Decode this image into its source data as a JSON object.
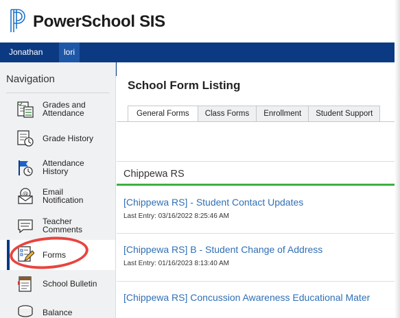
{
  "app": {
    "title": "PowerSchool SIS"
  },
  "user_bar": {
    "tabs": [
      "Jonathan",
      "lori"
    ]
  },
  "sidebar": {
    "heading": "Navigation",
    "items": [
      {
        "label_lines": [
          "Grades and",
          "Attendance"
        ],
        "icon": "gradebook-icon"
      },
      {
        "label_lines": [
          "Grade History"
        ],
        "icon": "grade-history-icon"
      },
      {
        "label_lines": [
          "Attendance",
          "History"
        ],
        "icon": "attendance-flag-icon"
      },
      {
        "label_lines": [
          "Email",
          "Notification"
        ],
        "icon": "email-icon"
      },
      {
        "label_lines": [
          "Teacher",
          "Comments"
        ],
        "icon": "comment-icon"
      },
      {
        "label_lines": [
          "Forms"
        ],
        "icon": "form-edit-icon",
        "active": true
      },
      {
        "label_lines": [
          "School Bulletin"
        ],
        "icon": "bulletin-icon"
      },
      {
        "label_lines": [
          "Balance"
        ],
        "icon": "coins-icon"
      }
    ]
  },
  "main": {
    "title": "School Form Listing",
    "tabs": [
      {
        "label": "General Forms",
        "active": true
      },
      {
        "label": "Class Forms"
      },
      {
        "label": "Enrollment"
      },
      {
        "label": "Student Support"
      }
    ],
    "school": "Chippewa RS",
    "forms": [
      {
        "title": "[Chippewa RS] - Student Contact Updates",
        "meta": "Last Entry: 03/16/2022 8:25:46 AM"
      },
      {
        "title": "[Chippewa RS] B - Student Change of Address",
        "meta": "Last Entry: 01/16/2023 8:13:40 AM"
      },
      {
        "title": "[Chippewa RS] Concussion Awareness Educational Mater",
        "meta": ""
      }
    ]
  },
  "colors": {
    "header_bar": "#0b3a82",
    "link": "#2f6fb5",
    "section_accent": "#3cb043",
    "highlight_oval": "#e8443f"
  }
}
